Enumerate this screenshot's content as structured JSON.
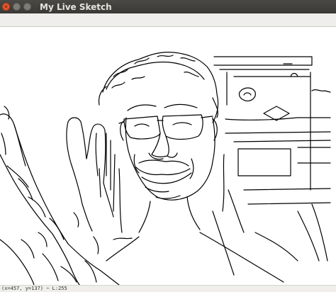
{
  "window": {
    "title": "My Live Sketch",
    "buttons": {
      "close_glyph": "×",
      "minimize_glyph": "",
      "maximize_glyph": ""
    }
  },
  "status": {
    "readout": "(x=457, y=137) ~ L:255"
  },
  "colors": {
    "titlebar": "#3f3e3a",
    "close_button": "#e9572f",
    "sketch_line": "#000000",
    "canvas_bg": "#ffffff"
  }
}
